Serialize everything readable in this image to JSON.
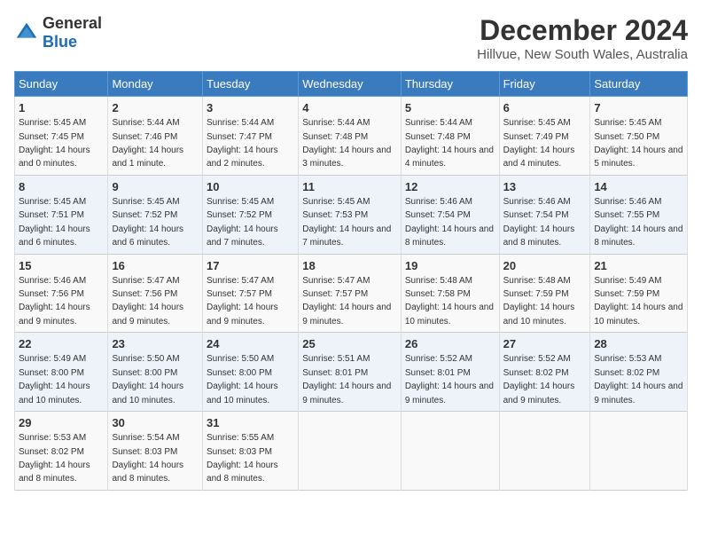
{
  "logo": {
    "general": "General",
    "blue": "Blue"
  },
  "title": "December 2024",
  "subtitle": "Hillvue, New South Wales, Australia",
  "headers": [
    "Sunday",
    "Monday",
    "Tuesday",
    "Wednesday",
    "Thursday",
    "Friday",
    "Saturday"
  ],
  "weeks": [
    [
      {
        "day": "1",
        "sunrise": "5:45 AM",
        "sunset": "7:45 PM",
        "daylight": "14 hours and 0 minutes."
      },
      {
        "day": "2",
        "sunrise": "5:44 AM",
        "sunset": "7:46 PM",
        "daylight": "14 hours and 1 minute."
      },
      {
        "day": "3",
        "sunrise": "5:44 AM",
        "sunset": "7:47 PM",
        "daylight": "14 hours and 2 minutes."
      },
      {
        "day": "4",
        "sunrise": "5:44 AM",
        "sunset": "7:48 PM",
        "daylight": "14 hours and 3 minutes."
      },
      {
        "day": "5",
        "sunrise": "5:44 AM",
        "sunset": "7:48 PM",
        "daylight": "14 hours and 4 minutes."
      },
      {
        "day": "6",
        "sunrise": "5:45 AM",
        "sunset": "7:49 PM",
        "daylight": "14 hours and 4 minutes."
      },
      {
        "day": "7",
        "sunrise": "5:45 AM",
        "sunset": "7:50 PM",
        "daylight": "14 hours and 5 minutes."
      }
    ],
    [
      {
        "day": "8",
        "sunrise": "5:45 AM",
        "sunset": "7:51 PM",
        "daylight": "14 hours and 6 minutes."
      },
      {
        "day": "9",
        "sunrise": "5:45 AM",
        "sunset": "7:52 PM",
        "daylight": "14 hours and 6 minutes."
      },
      {
        "day": "10",
        "sunrise": "5:45 AM",
        "sunset": "7:52 PM",
        "daylight": "14 hours and 7 minutes."
      },
      {
        "day": "11",
        "sunrise": "5:45 AM",
        "sunset": "7:53 PM",
        "daylight": "14 hours and 7 minutes."
      },
      {
        "day": "12",
        "sunrise": "5:46 AM",
        "sunset": "7:54 PM",
        "daylight": "14 hours and 8 minutes."
      },
      {
        "day": "13",
        "sunrise": "5:46 AM",
        "sunset": "7:54 PM",
        "daylight": "14 hours and 8 minutes."
      },
      {
        "day": "14",
        "sunrise": "5:46 AM",
        "sunset": "7:55 PM",
        "daylight": "14 hours and 8 minutes."
      }
    ],
    [
      {
        "day": "15",
        "sunrise": "5:46 AM",
        "sunset": "7:56 PM",
        "daylight": "14 hours and 9 minutes."
      },
      {
        "day": "16",
        "sunrise": "5:47 AM",
        "sunset": "7:56 PM",
        "daylight": "14 hours and 9 minutes."
      },
      {
        "day": "17",
        "sunrise": "5:47 AM",
        "sunset": "7:57 PM",
        "daylight": "14 hours and 9 minutes."
      },
      {
        "day": "18",
        "sunrise": "5:47 AM",
        "sunset": "7:57 PM",
        "daylight": "14 hours and 9 minutes."
      },
      {
        "day": "19",
        "sunrise": "5:48 AM",
        "sunset": "7:58 PM",
        "daylight": "14 hours and 10 minutes."
      },
      {
        "day": "20",
        "sunrise": "5:48 AM",
        "sunset": "7:59 PM",
        "daylight": "14 hours and 10 minutes."
      },
      {
        "day": "21",
        "sunrise": "5:49 AM",
        "sunset": "7:59 PM",
        "daylight": "14 hours and 10 minutes."
      }
    ],
    [
      {
        "day": "22",
        "sunrise": "5:49 AM",
        "sunset": "8:00 PM",
        "daylight": "14 hours and 10 minutes."
      },
      {
        "day": "23",
        "sunrise": "5:50 AM",
        "sunset": "8:00 PM",
        "daylight": "14 hours and 10 minutes."
      },
      {
        "day": "24",
        "sunrise": "5:50 AM",
        "sunset": "8:00 PM",
        "daylight": "14 hours and 10 minutes."
      },
      {
        "day": "25",
        "sunrise": "5:51 AM",
        "sunset": "8:01 PM",
        "daylight": "14 hours and 9 minutes."
      },
      {
        "day": "26",
        "sunrise": "5:52 AM",
        "sunset": "8:01 PM",
        "daylight": "14 hours and 9 minutes."
      },
      {
        "day": "27",
        "sunrise": "5:52 AM",
        "sunset": "8:02 PM",
        "daylight": "14 hours and 9 minutes."
      },
      {
        "day": "28",
        "sunrise": "5:53 AM",
        "sunset": "8:02 PM",
        "daylight": "14 hours and 9 minutes."
      }
    ],
    [
      {
        "day": "29",
        "sunrise": "5:53 AM",
        "sunset": "8:02 PM",
        "daylight": "14 hours and 8 minutes."
      },
      {
        "day": "30",
        "sunrise": "5:54 AM",
        "sunset": "8:03 PM",
        "daylight": "14 hours and 8 minutes."
      },
      {
        "day": "31",
        "sunrise": "5:55 AM",
        "sunset": "8:03 PM",
        "daylight": "14 hours and 8 minutes."
      },
      null,
      null,
      null,
      null
    ]
  ]
}
